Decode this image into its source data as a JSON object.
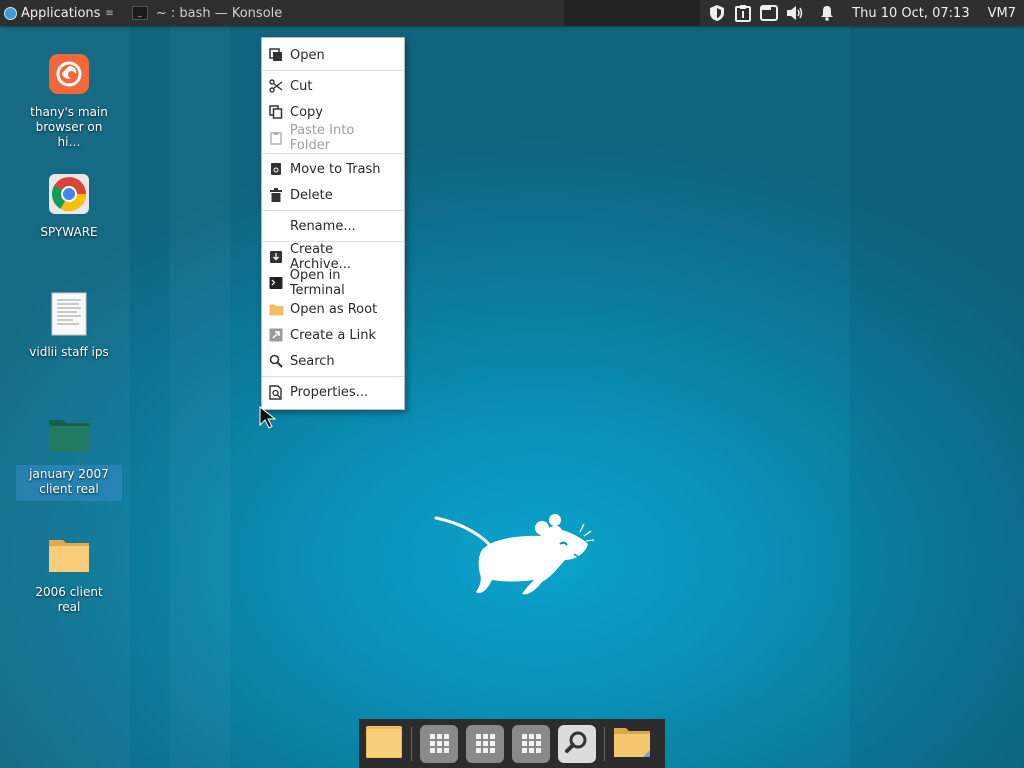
{
  "top_panel": {
    "applications_label": "Applications",
    "applications_arrow": "≡",
    "task_label": "~ : bash — Konsole",
    "clock": "Thu 10 Oct, 07:13",
    "vm_label": "VM7"
  },
  "desktop_icons": [
    {
      "label": "thany's main browser on hi…",
      "icon": "firefox-icon"
    },
    {
      "label": "SPYWARE",
      "icon": "chrome-icon"
    },
    {
      "label": "vidlii staff ips",
      "icon": "text-document-icon"
    },
    {
      "label": "january 2007 client real",
      "icon": "folder-dark-icon"
    },
    {
      "label": "2006 client real",
      "icon": "folder-icon"
    }
  ],
  "context_menu": {
    "open": "Open",
    "cut": "Cut",
    "copy": "Copy",
    "paste_into_folder": "Paste Into Folder",
    "move_to_trash": "Move to Trash",
    "delete": "Delete",
    "rename": "Rename...",
    "create_archive": "Create Archive...",
    "open_in_terminal": "Open in Terminal",
    "open_as_root": "Open as Root",
    "create_link": "Create a Link",
    "search": "Search",
    "properties": "Properties..."
  },
  "colors": {
    "desktop": "#0a8fb6",
    "panel": "#2f2f2f",
    "folder": "#f5c870",
    "folder_dark": "#1f6e5a"
  }
}
